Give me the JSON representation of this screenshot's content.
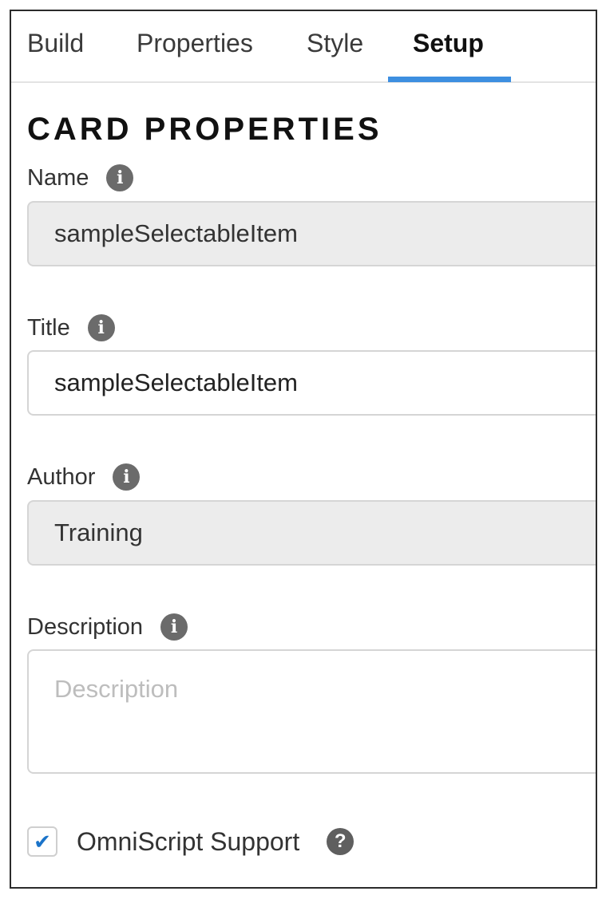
{
  "tabs": {
    "build": "Build",
    "properties": "Properties",
    "style": "Style",
    "setup": "Setup",
    "active": "Setup"
  },
  "section_title": "CARD PROPERTIES",
  "fields": {
    "name": {
      "label": "Name",
      "value": "sampleSelectableItem",
      "readonly": true
    },
    "title": {
      "label": "Title",
      "value": "sampleSelectableItem",
      "readonly": false
    },
    "author": {
      "label": "Author",
      "value": "Training",
      "readonly": true
    },
    "description": {
      "label": "Description",
      "value": "",
      "placeholder": "Description"
    }
  },
  "omniscript_support": {
    "label": "OmniScript Support",
    "checked": true
  },
  "icons": {
    "info": "info-icon",
    "help": "question-circle-icon",
    "check": "checkmark-icon"
  },
  "colors": {
    "accent": "#3d8fe0",
    "check": "#1a73c9",
    "readonly_bg": "#ececec"
  }
}
